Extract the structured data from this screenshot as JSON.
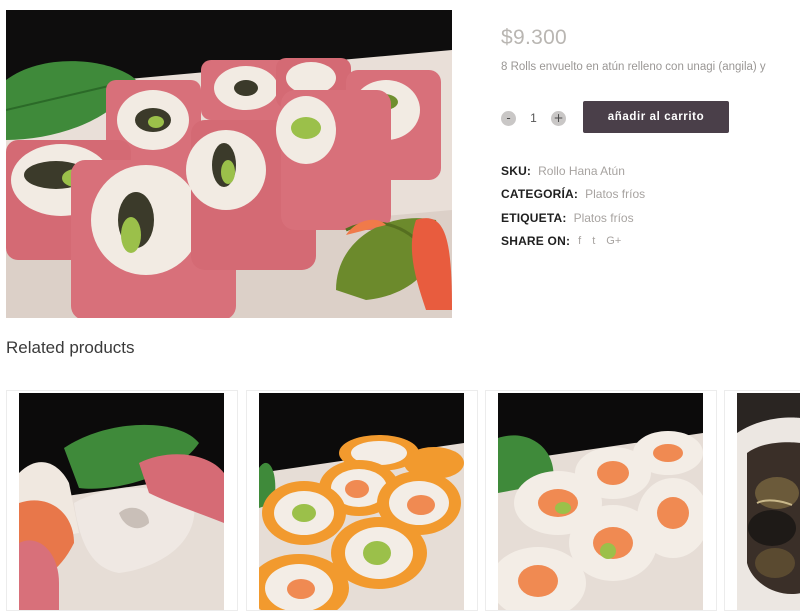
{
  "product": {
    "price": "$9.300",
    "description": "8 Rolls envuelto en atún relleno con unagi (angila) y",
    "quantity": "1",
    "qty_minus": "-",
    "qty_plus": "+",
    "add_to_cart_label": "añadir al carrito",
    "image_icon": "sushi-roll-photo"
  },
  "meta": {
    "sku_label": "SKU:",
    "sku_value": "Rollo Hana Atún",
    "category_label": "CATEGORÍA:",
    "category_value": "Platos fríos",
    "tag_label": "ETIQUETA:",
    "tag_value": "Platos fríos",
    "share_label": "SHARE ON:",
    "share_icons": [
      "f",
      "t",
      "G+"
    ]
  },
  "related": {
    "title": "Related products",
    "items": [
      {
        "icon": "sashimi-photo"
      },
      {
        "icon": "masago-roll-photo"
      },
      {
        "icon": "salmon-roll-photo"
      },
      {
        "icon": "bowl-photo"
      }
    ]
  },
  "colors": {
    "button_bg": "#4a3f49",
    "price": "#b9b6b2",
    "meta_value": "#a7a3a0",
    "tuna": "#d8707a",
    "rice": "#f2ebe3",
    "leaf": "#3f8a3a",
    "masago": "#f29a2e",
    "salmon": "#f08a52"
  }
}
